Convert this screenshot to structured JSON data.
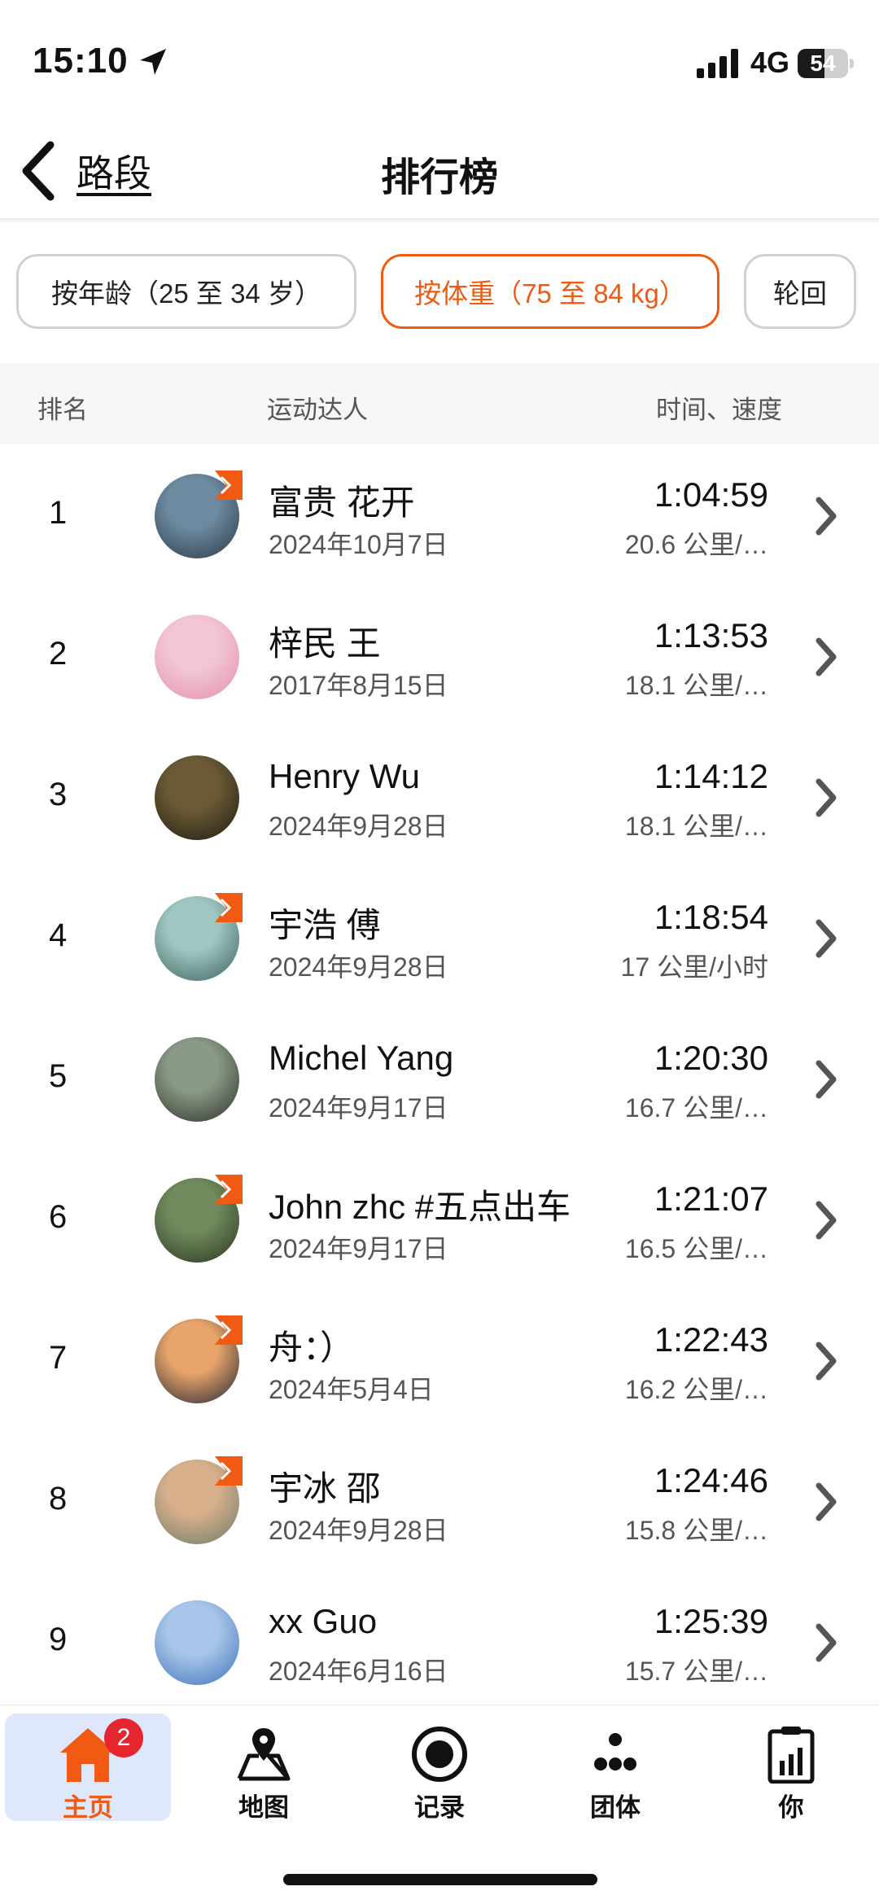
{
  "status_bar": {
    "time": "15:10",
    "network": "4G",
    "battery": "54",
    "battery_level": 0.54
  },
  "nav": {
    "back_label": "路段",
    "title": "排行榜"
  },
  "filters": [
    {
      "label": "按年龄（25 至 34 岁）",
      "active": false
    },
    {
      "label": "按体重（75 至 84 kg）",
      "active": true
    },
    {
      "label": "轮回",
      "active": false
    }
  ],
  "table_header": {
    "rank": "排名",
    "athlete": "运动达人",
    "time_speed": "时间、速度"
  },
  "entries": [
    {
      "rank": "1",
      "name": "富贵 花开",
      "date": "2024年10月7日",
      "time": "1:04:59",
      "speed": "20.6 公里/…",
      "subscriber": true,
      "avatar_colors": [
        "#6d8aa0",
        "#2b3a46"
      ]
    },
    {
      "rank": "2",
      "name": "梓民 王",
      "date": "2017年8月15日",
      "time": "1:13:53",
      "speed": "18.1 公里/…",
      "subscriber": false,
      "avatar_colors": [
        "#f2c6d4",
        "#e48fb0"
      ]
    },
    {
      "rank": "3",
      "name": "Henry Wu",
      "date": "2024年9月28日",
      "time": "1:14:12",
      "speed": "18.1 公里/…",
      "subscriber": false,
      "avatar_colors": [
        "#6b5a35",
        "#1e1a12"
      ]
    },
    {
      "rank": "4",
      "name": "宇浩 傅",
      "date": "2024年9月28日",
      "time": "1:18:54",
      "speed": "17 公里/小时",
      "subscriber": true,
      "avatar_colors": [
        "#9fc7c2",
        "#3d5f5b"
      ]
    },
    {
      "rank": "5",
      "name": "Michel Yang",
      "date": "2024年9月17日",
      "time": "1:20:30",
      "speed": "16.7 公里/…",
      "subscriber": false,
      "avatar_colors": [
        "#8a9a86",
        "#2c3029"
      ]
    },
    {
      "rank": "6",
      "name": "John zhc #五点出车",
      "date": "2024年9月17日",
      "time": "1:21:07",
      "speed": "16.5 公里/…",
      "subscriber": true,
      "avatar_colors": [
        "#6f8a5c",
        "#2a3521"
      ]
    },
    {
      "rank": "7",
      "name": "舟：）",
      "date": "2024年5月4日",
      "time": "1:22:43",
      "speed": "16.2 公里/…",
      "subscriber": true,
      "avatar_colors": [
        "#e8a46a",
        "#1f2433"
      ]
    },
    {
      "rank": "8",
      "name": "宇冰 邵",
      "date": "2024年9月28日",
      "time": "1:24:46",
      "speed": "15.8 公里/…",
      "subscriber": true,
      "avatar_colors": [
        "#d9b08c",
        "#6a7b6a"
      ]
    },
    {
      "rank": "9",
      "name": "xx Guo",
      "date": "2024年6月16日",
      "time": "1:25:39",
      "speed": "15.7 公里/…",
      "subscriber": false,
      "avatar_colors": [
        "#a9c6ea",
        "#3f73b8"
      ]
    }
  ],
  "tabbar": {
    "items": [
      {
        "label": "主页",
        "icon": "home-icon",
        "active": true,
        "badge": "2"
      },
      {
        "label": "地图",
        "icon": "map-icon",
        "active": false
      },
      {
        "label": "记录",
        "icon": "record-icon",
        "active": false
      },
      {
        "label": "团体",
        "icon": "groups-icon",
        "active": false
      },
      {
        "label": "你",
        "icon": "profile-icon",
        "active": false
      }
    ]
  },
  "colors": {
    "accent": "#f05a12",
    "active_tab_bg": "#dfe8fb",
    "badge_red": "#e6262e"
  }
}
